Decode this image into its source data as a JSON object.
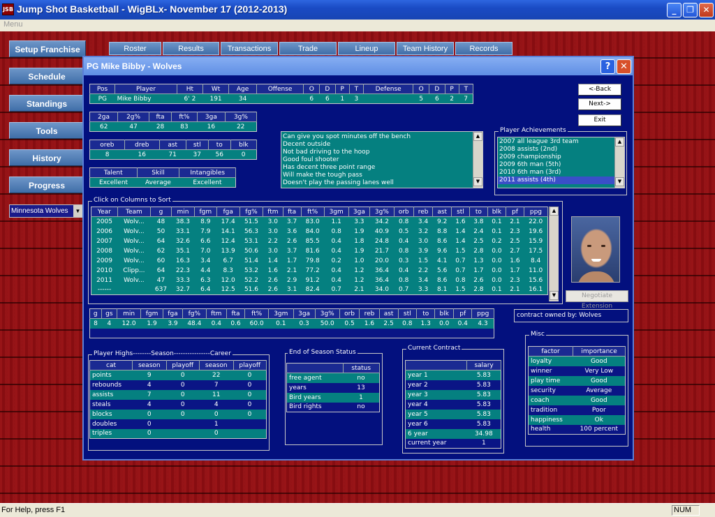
{
  "window": {
    "title": "Jump Shot Basketball - WigBLx- November 17 (2012-2013)",
    "icon_text": "JSB",
    "min": "_",
    "max": "❐",
    "close": "✕"
  },
  "menu": {
    "item": "Menu"
  },
  "nav": {
    "setup": "Setup Franchise",
    "schedule": "Schedule",
    "standings": "Standings",
    "tools": "Tools",
    "history": "History",
    "progress": "Progress"
  },
  "team_select": {
    "value": "Minnesota Wolves"
  },
  "tabs": [
    "Roster",
    "Results",
    "Transactions",
    "Trade",
    "Lineup",
    "Team History",
    "Records"
  ],
  "dialog": {
    "title": "PG Mike Bibby - Wolves",
    "help": "?",
    "close": "✕",
    "buttons": {
      "back": "<-Back",
      "next": "Next->",
      "exit": "Exit"
    },
    "player": {
      "headers": [
        "Pos",
        "Player",
        "Ht",
        "Wt",
        "Age",
        "Offense",
        "O",
        "D",
        "P",
        "T",
        "Defense",
        "O",
        "D",
        "P",
        "T"
      ],
      "row": [
        "PG",
        "Mike Bibby",
        "6' 2",
        "191",
        "34",
        "",
        "6",
        "6",
        "1",
        "3",
        "",
        "5",
        "6",
        "2",
        "7"
      ]
    },
    "shoot": {
      "headers": [
        "2ga",
        "2g%",
        "fta",
        "ft%",
        "3ga",
        "3g%"
      ],
      "row": [
        "62",
        "47",
        "28",
        "83",
        "16",
        "22"
      ]
    },
    "misc_ratings": {
      "headers": [
        "oreb",
        "dreb",
        "ast",
        "stl",
        "to",
        "blk"
      ],
      "row": [
        "8",
        "16",
        "71",
        "37",
        "56",
        "0"
      ]
    },
    "talent": {
      "headers": [
        "Talent",
        "Skill",
        "Intangibles"
      ],
      "row": [
        "Excellent",
        "Average",
        "Excellent"
      ]
    },
    "scouting": [
      "Can give you spot minutes off the bench",
      "Decent outside",
      "Not bad driving to the hoop",
      "Good foul shooter",
      "Has decent three point range",
      "Will make the tough pass",
      "Doesn't play the passing lanes well"
    ],
    "achievements": {
      "label": "Player Achievements",
      "items": [
        "2007 all league 3rd team",
        "2008 assists (2nd)",
        "2009 championship",
        "2009 6th man (5th)",
        "2010 6th man (3rd)",
        "2011 assists (4th)"
      ]
    },
    "stats": {
      "label": "Click on Columns to Sort",
      "headers": [
        "Year",
        "Team",
        "g",
        "min",
        "fgm",
        "fga",
        "fg%",
        "ftm",
        "fta",
        "ft%",
        "3gm",
        "3ga",
        "3g%",
        "orb",
        "reb",
        "ast",
        "stl",
        "to",
        "blk",
        "pf",
        "ppg"
      ],
      "rows": [
        [
          "2005",
          "Wolv...",
          "48",
          "38.3",
          "8.9",
          "17.4",
          "51.5",
          "3.0",
          "3.7",
          "83.0",
          "1.1",
          "3.3",
          "34.2",
          "0.8",
          "3.4",
          "9.2",
          "1.6",
          "3.8",
          "0.1",
          "2.1",
          "22.0"
        ],
        [
          "2006",
          "Wolv...",
          "50",
          "33.1",
          "7.9",
          "14.1",
          "56.3",
          "3.0",
          "3.6",
          "84.0",
          "0.8",
          "1.9",
          "40.9",
          "0.5",
          "3.2",
          "8.8",
          "1.4",
          "2.4",
          "0.1",
          "2.3",
          "19.6"
        ],
        [
          "2007",
          "Wolv...",
          "64",
          "32.6",
          "6.6",
          "12.4",
          "53.1",
          "2.2",
          "2.6",
          "85.5",
          "0.4",
          "1.8",
          "24.8",
          "0.4",
          "3.0",
          "8.6",
          "1.4",
          "2.5",
          "0.2",
          "2.5",
          "15.9"
        ],
        [
          "2008",
          "Wolv...",
          "62",
          "35.1",
          "7.0",
          "13.9",
          "50.6",
          "3.0",
          "3.7",
          "81.6",
          "0.4",
          "1.9",
          "21.7",
          "0.8",
          "3.9",
          "9.6",
          "1.5",
          "2.8",
          "0.0",
          "2.7",
          "17.5"
        ],
        [
          "2009",
          "Wolv...",
          "60",
          "16.3",
          "3.4",
          "6.7",
          "51.4",
          "1.4",
          "1.7",
          "79.8",
          "0.2",
          "1.0",
          "20.0",
          "0.3",
          "1.5",
          "4.1",
          "0.7",
          "1.3",
          "0.0",
          "1.6",
          "8.4"
        ],
        [
          "2010",
          "Clipp...",
          "64",
          "22.3",
          "4.4",
          "8.3",
          "53.2",
          "1.6",
          "2.1",
          "77.2",
          "0.4",
          "1.2",
          "36.4",
          "0.4",
          "2.2",
          "5.6",
          "0.7",
          "1.7",
          "0.0",
          "1.7",
          "11.0"
        ],
        [
          "2011",
          "Wolv...",
          "47",
          "33.3",
          "6.3",
          "12.0",
          "52.2",
          "2.6",
          "2.9",
          "91.2",
          "0.4",
          "1.2",
          "36.4",
          "0.8",
          "3.4",
          "8.6",
          "0.8",
          "2.6",
          "0.0",
          "2.3",
          "15.6"
        ],
        [
          "------",
          "",
          "637",
          "32.7",
          "6.4",
          "12.5",
          "51.6",
          "2.6",
          "3.1",
          "82.4",
          "0.7",
          "2.1",
          "34.0",
          "0.7",
          "3.3",
          "8.1",
          "1.5",
          "2.8",
          "0.1",
          "2.1",
          "16.1"
        ]
      ]
    },
    "current": {
      "headers": [
        "g",
        "gs",
        "min",
        "fgm",
        "fga",
        "fg%",
        "ftm",
        "fta",
        "ft%",
        "3gm",
        "3ga",
        "3g%",
        "orb",
        "reb",
        "ast",
        "stl",
        "to",
        "blk",
        "pf",
        "ppg"
      ],
      "row": [
        "8",
        "4",
        "12.0",
        "1.9",
        "3.9",
        "48.4",
        "0.4",
        "0.6",
        "60.0",
        "0.1",
        "0.3",
        "50.0",
        "0.5",
        "1.6",
        "2.5",
        "0.8",
        "1.3",
        "0.0",
        "0.4",
        "4.3"
      ]
    },
    "negotiate": "Negotiate Extension",
    "contract_owned": "contract owned by: Wolves",
    "highs": {
      "label": "Player Highs--------Season----------------Career",
      "headers": [
        "cat",
        "season",
        "playoff",
        "season",
        "playoff"
      ],
      "rows": [
        [
          "points",
          "9",
          "0",
          "22",
          "0"
        ],
        [
          "rebounds",
          "4",
          "0",
          "7",
          "0"
        ],
        [
          "assists",
          "7",
          "0",
          "11",
          "0"
        ],
        [
          "steals",
          "4",
          "0",
          "4",
          "0"
        ],
        [
          "blocks",
          "0",
          "0",
          "0",
          "0"
        ],
        [
          "doubles",
          "0",
          "",
          "1",
          ""
        ],
        [
          "triples",
          "0",
          "",
          "0",
          ""
        ]
      ]
    },
    "eos": {
      "label": "End of Season Status",
      "headers": [
        "",
        "status"
      ],
      "rows": [
        [
          "free agent",
          "no"
        ],
        [
          "years",
          "13"
        ],
        [
          "Bird years",
          "1"
        ],
        [
          "Bird rights",
          "no"
        ]
      ]
    },
    "contract": {
      "label": "Current Contract",
      "headers": [
        "",
        "salary"
      ],
      "rows": [
        [
          "year 1",
          "5.83"
        ],
        [
          "year 2",
          "5.83"
        ],
        [
          "year 3",
          "5.83"
        ],
        [
          "year 4",
          "5.83"
        ],
        [
          "year 5",
          "5.83"
        ],
        [
          "year 6",
          "5.83"
        ],
        [
          "6 year",
          "34.98"
        ],
        [
          "current year",
          "1"
        ]
      ]
    },
    "misc": {
      "label": "Misc",
      "headers": [
        "factor",
        "importance"
      ],
      "rows": [
        [
          "loyalty",
          "Good"
        ],
        [
          "winner",
          "Very Low"
        ],
        [
          "play time",
          "Good"
        ],
        [
          "security",
          "Average"
        ],
        [
          "coach",
          "Good"
        ],
        [
          "tradition",
          "Poor"
        ],
        [
          "happiness",
          "Ok"
        ],
        [
          "health",
          "100 percent"
        ]
      ]
    }
  },
  "status": {
    "text": "For Help, press F1",
    "num": "NUM"
  }
}
